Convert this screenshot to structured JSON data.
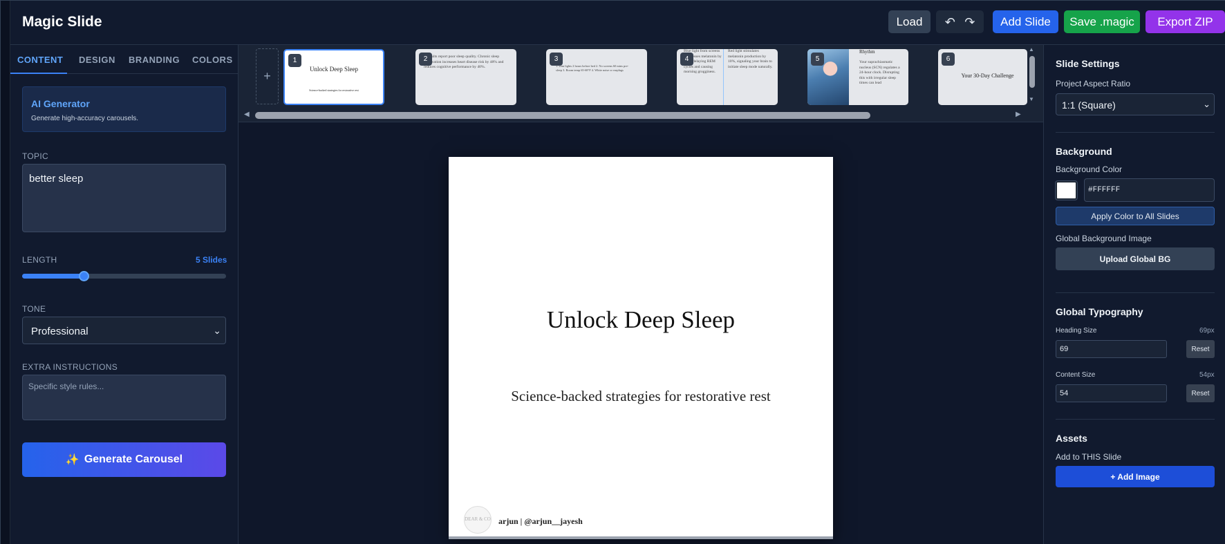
{
  "header": {
    "title": "Magic Slide",
    "load_label": "Load",
    "undo_icon": "undo-icon",
    "redo_icon": "redo-icon",
    "add_slide_label": "Add Slide",
    "save_label": "Save .magic",
    "export_label": "Export ZIP"
  },
  "left_panel": {
    "tabs": [
      {
        "label": "CONTENT",
        "active": true
      },
      {
        "label": "DESIGN",
        "active": false
      },
      {
        "label": "BRANDING",
        "active": false
      },
      {
        "label": "COLORS",
        "active": false
      }
    ],
    "ai_card": {
      "title": "AI Generator",
      "subtitle": "Generate high-accuracy carousels."
    },
    "topic": {
      "label": "TOPIC",
      "value": "better sleep"
    },
    "length": {
      "label": "LENGTH",
      "value_label": "5 Slides",
      "fraction": 0.3
    },
    "tone": {
      "label": "TONE",
      "value": "Professional"
    },
    "extra": {
      "label": "EXTRA INSTRUCTIONS",
      "placeholder": "Specific style rules..."
    },
    "generate_label": "Generate Carousel",
    "generate_icon": "sparkles-icon"
  },
  "thumbnails": [
    {
      "num": "1",
      "title": "Unlock Deep Sleep",
      "subtitle": "Science-backed strategies for restorative rest"
    },
    {
      "num": "2",
      "text": "of adults report poor sleep quality. Chronic sleep deprivation increases heart disease risk by 48% and reduces cognitive performance by 40%."
    },
    {
      "num": "3",
      "text": "1. Dim lights 2 hours before bed 2. No screens 60 mins pre-sleep 3. Room temp 65-68°F 4. White noise or earplugs"
    },
    {
      "num": "4",
      "text_a": "Blue light from screens suppresses melatonin by 50%, delaying REM cycles and causing morning grogginess.",
      "text_b": "Red light stimulates melatonin production by 10%, signaling your brain to initiate sleep mode naturally."
    },
    {
      "num": "5",
      "title": "Rhythm",
      "text": "Your suprachiasmatic nucleus (SCN) regulates a 24-hour clock. Disrupting this with irregular sleep times can lead"
    },
    {
      "num": "6",
      "title": "Your 30-Day Challenge"
    }
  ],
  "canvas": {
    "heading": "Unlock Deep Sleep",
    "subtitle": "Science-backed strategies for restorative rest",
    "logo_text": "DEAR & CO",
    "handle": "arjun | @arjun__jayesh",
    "background": "#FFFFFF"
  },
  "right_panel": {
    "title": "Slide Settings",
    "aspect_label": "Project Aspect Ratio",
    "aspect_value": "1:1 (Square)",
    "background_heading": "Background",
    "background_color_label": "Background Color",
    "background_hex": "#FFFFFF",
    "apply_label": "Apply Color to All Slides",
    "global_bg_label": "Global Background Image",
    "upload_bg_label": "Upload Global BG",
    "typography_heading": "Global Typography",
    "heading_size_label": "Heading Size",
    "heading_size_px": "69px",
    "heading_size_value": "69",
    "content_size_label": "Content Size",
    "content_size_px": "54px",
    "content_size_value": "54",
    "reset_label": "Reset",
    "assets_heading": "Assets",
    "assets_label": "Add to THIS Slide",
    "add_image_label": "+ Add Image"
  },
  "colors": {
    "accent": "#3b82f6",
    "add_slide": "#2563eb",
    "save": "#16a34a",
    "export": "#9333ea"
  }
}
